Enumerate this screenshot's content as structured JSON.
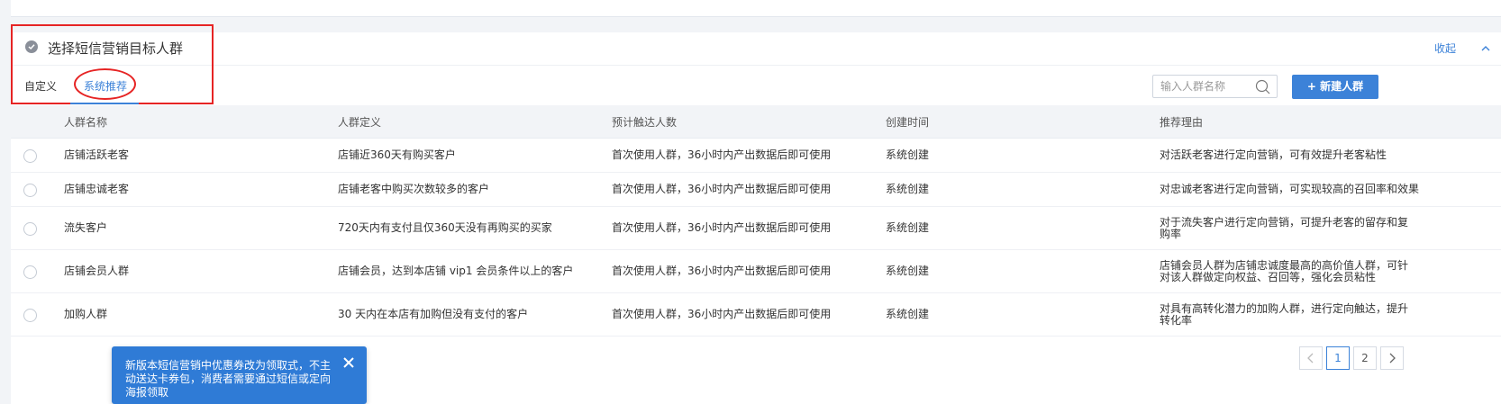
{
  "section": {
    "title": "选择短信营销目标人群",
    "collapse_label": "收起"
  },
  "tabs": [
    {
      "label": "自定义",
      "active": false
    },
    {
      "label": "系统推荐",
      "active": true
    }
  ],
  "search": {
    "placeholder": "输入人群名称",
    "value": ""
  },
  "new_button_label": "+ 新建人群",
  "table": {
    "headers": [
      "人群名称",
      "人群定义",
      "预计触达人数",
      "创建时间",
      "推荐理由"
    ],
    "rows": [
      {
        "name": "店铺活跃老客",
        "definition": "店铺近360天有购买客户",
        "reach": "首次使用人群，36小时内产出数据后即可使用",
        "created": "系统创建",
        "reason": "对活跃老客进行定向营销，可有效提升老客粘性"
      },
      {
        "name": "店铺忠诚老客",
        "definition": "店铺老客中购买次数较多的客户",
        "reach": "首次使用人群，36小时内产出数据后即可使用",
        "created": "系统创建",
        "reason": "对忠诚老客进行定向营销，可实现较高的召回率和效果"
      },
      {
        "name": "流失客户",
        "definition": "720天内有支付且仅360天没有再购买的买家",
        "reach": "首次使用人群，36小时内产出数据后即可使用",
        "created": "系统创建",
        "reason": "对于流失客户进行定向营销，可提升老客的留存和复购率"
      },
      {
        "name": "店铺会员人群",
        "definition": "店铺会员，达到本店铺 vip1 会员条件以上的客户",
        "reach": "首次使用人群，36小时内产出数据后即可使用",
        "created": "系统创建",
        "reason": "店铺会员人群为店铺忠诚度最高的高价值人群，可针对该人群做定向权益、召回等，强化会员粘性"
      },
      {
        "name": "加购人群",
        "definition": "30 天内在本店有加购但没有支付的客户",
        "reach": "首次使用人群，36小时内产出数据后即可使用",
        "created": "系统创建",
        "reason": "对具有高转化潜力的加购人群，进行定向触达，提升转化率"
      }
    ]
  },
  "pagination": {
    "pages": [
      "1",
      "2"
    ],
    "current": "1"
  },
  "toast": {
    "text": "新版本短信营销中优惠券改为领取式，不主动送达卡券包，消费者需要通过短信或定向海报领取"
  },
  "colors": {
    "accent": "#3c82d8",
    "annotation": "#e62424",
    "toast_bg": "#2f7bd6"
  }
}
